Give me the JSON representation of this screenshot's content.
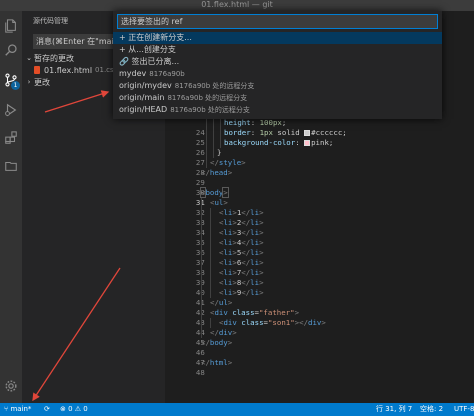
{
  "window": {
    "title": "01.flex.html — git"
  },
  "sidebar": {
    "header": "源代码管理",
    "commit_placeholder": "消息(⌘Enter 在\"main\"提交)",
    "staged_label": "暂存的更改",
    "file_name": "01.flex.html",
    "file_path": "01.css",
    "changes_label": "更改"
  },
  "quickpick": {
    "placeholder": "选择要签出的 ref",
    "items": [
      {
        "label": "+ 正在创建新分支...",
        "desc": ""
      },
      {
        "label": "+ 从...创建分支",
        "desc": ""
      },
      {
        "label": "签出已分离...",
        "desc": ""
      },
      {
        "label": "mydev",
        "desc": "8176a90b"
      },
      {
        "label": "origin/mydev",
        "desc": "8176a90b 处的远程分支"
      },
      {
        "label": "origin/main",
        "desc": "8176a90b 处的远程分支"
      },
      {
        "label": "origin/HEAD",
        "desc": "8176a90b 处的远程分支"
      }
    ]
  },
  "editor": {
    "active_line": "31",
    "lines": [
      {
        "n": "24",
        "t": "height: 100px;"
      },
      {
        "n": "25",
        "t": "border: 1px solid #cccccc;"
      },
      {
        "n": "26",
        "t": "background-color: pink;"
      },
      {
        "n": "27",
        "t": "}"
      },
      {
        "n": "28",
        "t": "</style>"
      },
      {
        "n": "29",
        "t": "</head>"
      },
      {
        "n": "30",
        "t": ""
      },
      {
        "n": "31",
        "t": "<body>"
      },
      {
        "n": "32",
        "t": "<ul>"
      },
      {
        "n": "33",
        "t": "<li>1</li>"
      },
      {
        "n": "34",
        "t": "<li>2</li>"
      },
      {
        "n": "35",
        "t": "<li>3</li>"
      },
      {
        "n": "36",
        "t": "<li>4</li>"
      },
      {
        "n": "37",
        "t": "<li>5</li>"
      },
      {
        "n": "38",
        "t": "<li>6</li>"
      },
      {
        "n": "39",
        "t": "<li>7</li>"
      },
      {
        "n": "40",
        "t": "<li>8</li>"
      },
      {
        "n": "41",
        "t": "<li>9</li>"
      },
      {
        "n": "42",
        "t": "</ul>"
      },
      {
        "n": "43",
        "t": "<div class=\"father\">"
      },
      {
        "n": "44",
        "t": "<div class=\"son1\"></div>"
      },
      {
        "n": "45",
        "t": "</div>"
      },
      {
        "n": "46",
        "t": "</body>"
      },
      {
        "n": "47",
        "t": ""
      },
      {
        "n": "48",
        "t": "</html>"
      }
    ]
  },
  "statusbar": {
    "branch": "main*",
    "problems": "⊗ 0 ⚠ 0",
    "cursor": "行 31, 列 7",
    "indent": "空格: 2",
    "encoding": "UTF-8"
  },
  "colors": {
    "accent": "#007acc",
    "selection": "#04395e",
    "arrow": "#e0463a"
  },
  "icons": [
    "files-icon",
    "search-icon",
    "source-control-icon",
    "run-debug-icon",
    "extensions-icon",
    "remote-explorer-icon",
    "settings-gear-icon",
    "branch-icon",
    "sync-icon"
  ]
}
